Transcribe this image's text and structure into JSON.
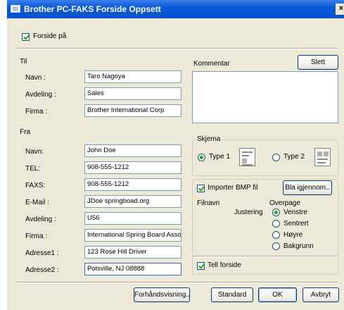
{
  "window": {
    "title": "Brother PC-FAKS Forside Oppsett",
    "close_glyph": "×"
  },
  "cover_toggle": {
    "label": "Forside på",
    "checked": true
  },
  "til": {
    "heading": "Til",
    "fields": [
      {
        "label": "Navn :",
        "value": "Taro Nagoya"
      },
      {
        "label": "Avdeling :",
        "value": "Sales"
      },
      {
        "label": "Firma :",
        "value": "Brother International Corp"
      }
    ]
  },
  "fra": {
    "heading": "Fra",
    "fields": [
      {
        "label": "Navn:",
        "value": "John Doe"
      },
      {
        "label": "TEL:",
        "value": "908-555-1212"
      },
      {
        "label": "FAXS:",
        "value": "908-555-1212"
      },
      {
        "label": "E-Mail :",
        "value": "JDoe springboad.org"
      },
      {
        "label": "Avdeling :",
        "value": "U56"
      },
      {
        "label": "Firma :",
        "value": "International Spring Board Asso"
      },
      {
        "label": "Adresse1 :",
        "value": "123 Rose Hill Driver"
      },
      {
        "label": "Adresse2 :",
        "value": "Potsville, NJ 08888"
      }
    ]
  },
  "comment": {
    "label": "Kommentar",
    "clear_button": "Slett",
    "value": ""
  },
  "skjema": {
    "label": "Skjema",
    "options": [
      {
        "label": "Type 1",
        "selected": true
      },
      {
        "label": "Type 2",
        "selected": false
      }
    ]
  },
  "bmp": {
    "import_label": "Importer BMP fil",
    "import_checked": true,
    "browse_button": "Bla igjennom..",
    "filename_label": "Filnavn",
    "overpage_label": "Overpage",
    "justify_label": "Justering",
    "justify_options": [
      {
        "label": "Venstre",
        "selected": true
      },
      {
        "label": "Sentrert",
        "selected": false
      },
      {
        "label": "Høyre",
        "selected": false
      },
      {
        "label": "Bakgrunn",
        "selected": false
      }
    ],
    "count_label": "Tell forside",
    "count_checked": true
  },
  "footer": {
    "preview_button": "Forhåndsvisning..",
    "standard_button": "Standard",
    "ok_button": "OK",
    "cancel_button": "Avbryt"
  }
}
